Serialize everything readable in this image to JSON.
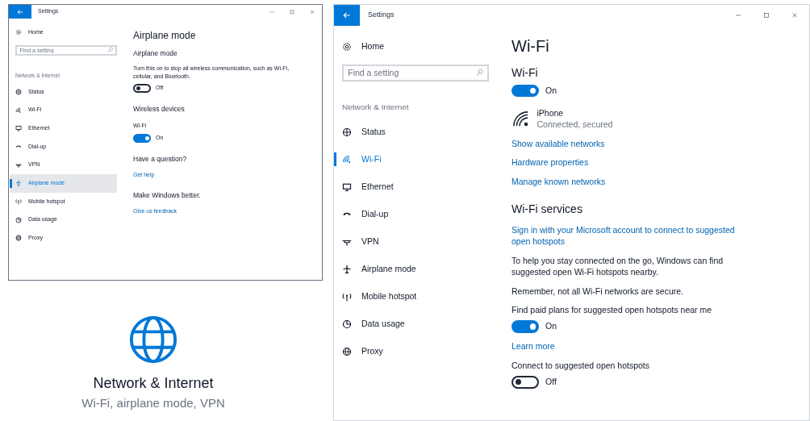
{
  "windows": [
    {
      "title": "Settings",
      "sidebar": {
        "home": "Home",
        "search_placeholder": "Find a setting",
        "section": "Network & Internet",
        "items": [
          {
            "label": "Status",
            "selected": false
          },
          {
            "label": "Wi-Fi",
            "selected": false
          },
          {
            "label": "Ethernet",
            "selected": false
          },
          {
            "label": "Dial-up",
            "selected": false
          },
          {
            "label": "VPN",
            "selected": false
          },
          {
            "label": "Airplane mode",
            "selected": true
          },
          {
            "label": "Mobile hotspot",
            "selected": false
          },
          {
            "label": "Data usage",
            "selected": false
          },
          {
            "label": "Proxy",
            "selected": false
          }
        ]
      },
      "content": [
        {
          "kind": "title",
          "text": "Airplane mode"
        },
        {
          "kind": "subheading",
          "text": "Airplane mode"
        },
        {
          "kind": "text",
          "text": "Turn this on to stop all wireless communication, such as Wi-Fi, cellular, and Bluetooth."
        },
        {
          "kind": "toggle",
          "on": false,
          "label": "Off"
        },
        {
          "kind": "subheading",
          "text": "Wireless devices"
        },
        {
          "kind": "caption",
          "text": "Wi-Fi"
        },
        {
          "kind": "toggle",
          "on": true,
          "label": "On"
        },
        {
          "kind": "subheading",
          "text": "Have a question?"
        },
        {
          "kind": "link",
          "text": "Get help"
        },
        {
          "kind": "subheading",
          "text": "Make Windows better."
        },
        {
          "kind": "link",
          "text": "Give us feedback"
        }
      ]
    },
    {
      "title": "Settings",
      "sidebar": {
        "home": "Home",
        "search_placeholder": "Find a setting",
        "section": "Network & Internet",
        "items": [
          {
            "label": "Status",
            "selected": false
          },
          {
            "label": "Wi-Fi",
            "selected": true
          },
          {
            "label": "Ethernet",
            "selected": false
          },
          {
            "label": "Dial-up",
            "selected": false
          },
          {
            "label": "VPN",
            "selected": false
          },
          {
            "label": "Airplane mode",
            "selected": false
          },
          {
            "label": "Mobile hotspot",
            "selected": false
          },
          {
            "label": "Data usage",
            "selected": false
          },
          {
            "label": "Proxy",
            "selected": false
          }
        ]
      },
      "content": [
        {
          "kind": "title",
          "text": "Wi-Fi"
        },
        {
          "kind": "subheading",
          "text": "Wi-Fi"
        },
        {
          "kind": "toggle",
          "on": true,
          "label": "On"
        },
        {
          "kind": "network",
          "name": "iPhone",
          "status": "Connected, secured"
        },
        {
          "kind": "link",
          "text": "Show available networks"
        },
        {
          "kind": "link",
          "text": "Hardware properties"
        },
        {
          "kind": "link",
          "text": "Manage known networks"
        },
        {
          "kind": "subheading",
          "text": "Wi-Fi services"
        },
        {
          "kind": "link",
          "text": "Sign in with your Microsoft account to connect to suggested open hotspots"
        },
        {
          "kind": "text",
          "text": "To help you stay connected on the go, Windows can find suggested open Wi-Fi hotspots nearby."
        },
        {
          "kind": "text",
          "text": "Remember, not all Wi-Fi networks are secure."
        },
        {
          "kind": "caption",
          "text": "Find paid plans for suggested open hotspots near me"
        },
        {
          "kind": "toggle",
          "on": true,
          "label": "On"
        },
        {
          "kind": "link",
          "text": "Learn more"
        },
        {
          "kind": "caption",
          "text": "Connect to suggested open hotspots"
        },
        {
          "kind": "toggle",
          "on": false,
          "label": "Off"
        }
      ]
    }
  ],
  "tile": {
    "title": "Network & Internet",
    "subtitle": "Wi-Fi, airplane mode, VPN"
  }
}
